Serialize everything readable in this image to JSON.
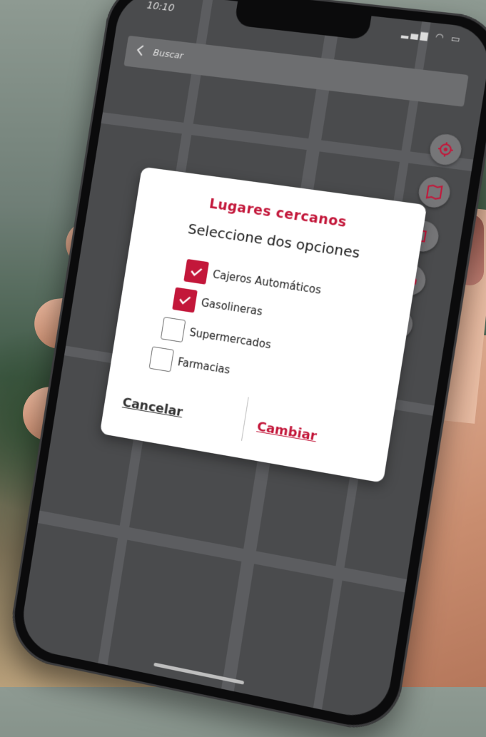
{
  "status": {
    "time": "10:10"
  },
  "search": {
    "label": "Buscar"
  },
  "dialog": {
    "title": "Lugares cercanos",
    "subtitle": "Seleccione dos opciones",
    "options": [
      {
        "label": "Cajeros Automáticos",
        "checked": true
      },
      {
        "label": "Gasolineras",
        "checked": true
      },
      {
        "label": "Supermercados",
        "checked": false
      },
      {
        "label": "Farmacias",
        "checked": false
      }
    ],
    "cancel_label": "Cancelar",
    "confirm_label": "Cambiar"
  },
  "side_buttons": [
    "locate-icon",
    "map-icon",
    "fuel-icon",
    "car-icon",
    "parking-icon",
    "atm-icon",
    "gear-icon"
  ],
  "colors": {
    "accent": "#c3173a",
    "dialog_bg": "#ffffff",
    "map_bg": "#4a4b4d"
  }
}
